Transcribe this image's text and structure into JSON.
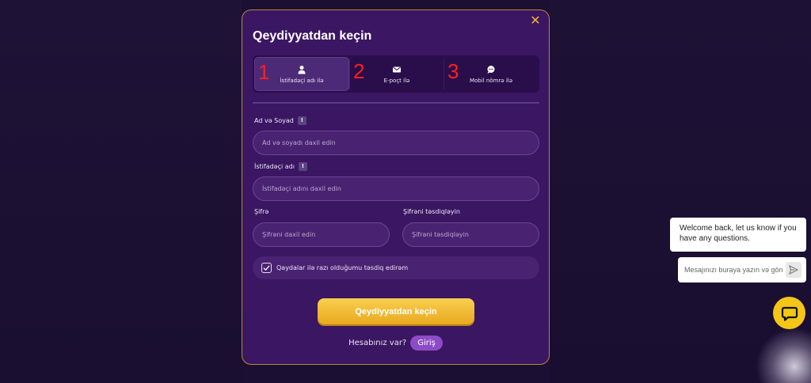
{
  "modal": {
    "title": "Qeydiyyatdan keçin",
    "tabs": [
      {
        "number": "1",
        "label": "İstifadəçi adı ilə",
        "icon": "user-icon"
      },
      {
        "number": "2",
        "label": "E-poçt ilə",
        "icon": "envelope-icon"
      },
      {
        "number": "3",
        "label": "Mobil nömrə ilə",
        "icon": "chat-icon"
      }
    ],
    "fields": {
      "fullname_label": "Ad və Soyad",
      "fullname_placeholder": "Ad və soyadı daxil edin",
      "username_label": "İstifadəçi adı",
      "username_placeholder": "İstifadəçi adını daxil edin",
      "password_label": "Şifrə",
      "password_placeholder": "Şifrəni daxil edin",
      "confirm_label": "Şifrəni təsdiqləyin",
      "confirm_placeholder": "Şifrəni təsdiqləyin",
      "info_glyph": "!"
    },
    "agree_text": "Qaydalar ilə razı olduğumu təsdiq edirəm",
    "submit_label": "Qeydiyyatdan keçin",
    "login_question": "Hesabınız var?",
    "login_label": "Giriş",
    "close_glyph": "✕"
  },
  "chat": {
    "welcome_text": "Welcome back, let us know if you have any questions.",
    "input_placeholder": "Mesajınızı buraya yazın və gön"
  },
  "colors": {
    "accent": "#f5c518",
    "modal_bg": "#3b1663",
    "tab_number": "#ff1f1f"
  }
}
